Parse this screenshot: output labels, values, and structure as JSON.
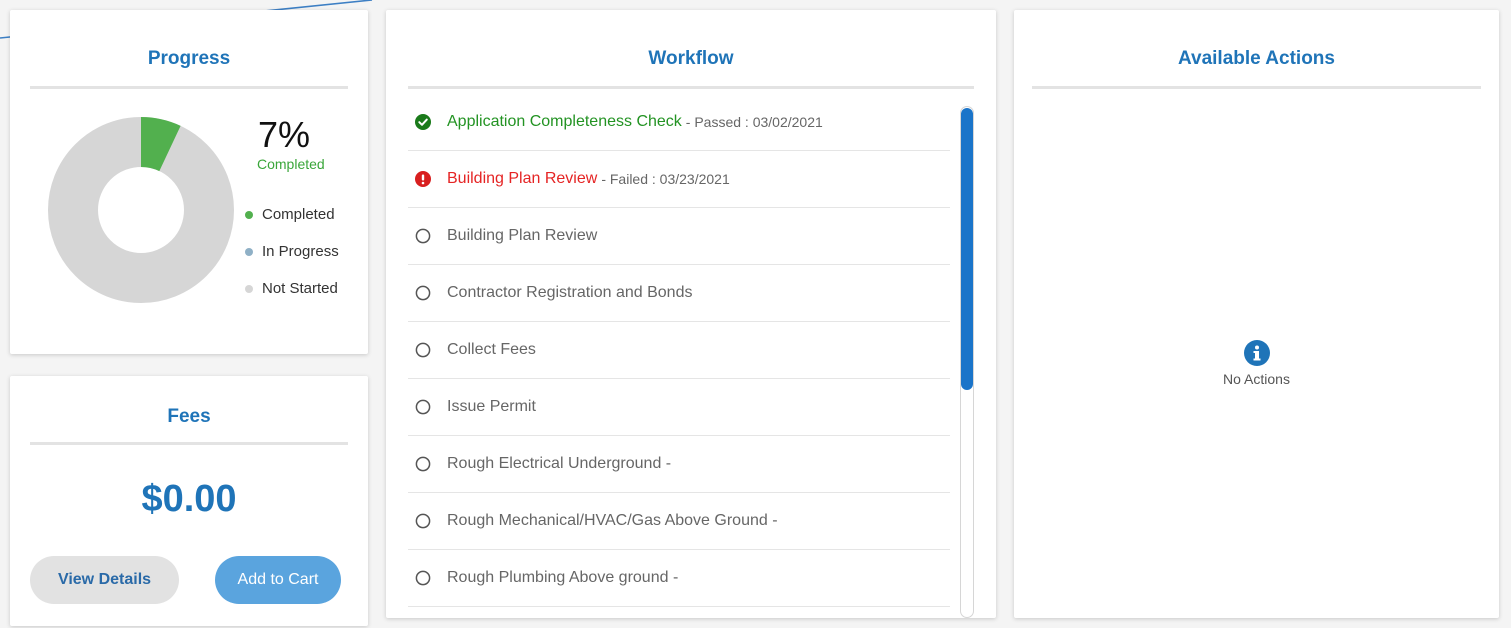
{
  "progress": {
    "title": "Progress",
    "percent_text": "7%",
    "percent_label": "Completed",
    "completed_fraction": 0.07,
    "colors": {
      "completed": "#52b04e",
      "in_progress": "#8fb0c6",
      "not_started": "#d6d6d6"
    },
    "legend": [
      {
        "label": "Completed",
        "color": "#52b04e"
      },
      {
        "label": "In Progress",
        "color": "#8fb0c6"
      },
      {
        "label": "Not Started",
        "color": "#d6d6d6"
      }
    ]
  },
  "fees": {
    "title": "Fees",
    "amount": "$0.00",
    "view_details_label": "View Details",
    "add_to_cart_label": "Add to Cart"
  },
  "workflow": {
    "title": "Workflow",
    "items": [
      {
        "status": "passed",
        "name": "Application Completeness Check",
        "meta": "- Passed : 03/02/2021"
      },
      {
        "status": "failed",
        "name": "Building Plan Review",
        "meta": "- Failed : 03/23/2021"
      },
      {
        "status": "pending",
        "name": "Building Plan Review",
        "meta": ""
      },
      {
        "status": "pending",
        "name": "Contractor Registration and Bonds",
        "meta": ""
      },
      {
        "status": "pending",
        "name": "Collect Fees",
        "meta": ""
      },
      {
        "status": "pending",
        "name": "Issue Permit",
        "meta": ""
      },
      {
        "status": "pending",
        "name": "Rough Electrical Underground -",
        "meta": ""
      },
      {
        "status": "pending",
        "name": "Rough Mechanical/HVAC/Gas Above Ground -",
        "meta": ""
      },
      {
        "status": "pending",
        "name": "Rough Plumbing Above ground -",
        "meta": ""
      }
    ]
  },
  "actions": {
    "title": "Available Actions",
    "empty_text": "No Actions",
    "icon": "info-icon"
  }
}
